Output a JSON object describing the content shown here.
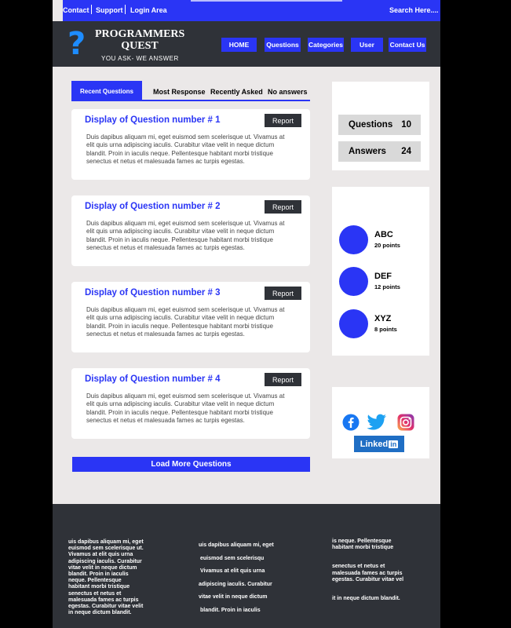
{
  "topbar": {
    "contact": "Contact",
    "support": "Support",
    "login": "Login Area",
    "search": "Search Here...."
  },
  "header": {
    "logo_title_line1": "PROGRAMMERS",
    "logo_title_line2": "QUEST",
    "tagline": "YOU ASK- WE ANSWER",
    "logo_icon": "question-mark"
  },
  "nav": [
    "HOME",
    "Questions",
    "Categories",
    "User",
    "Contact Us"
  ],
  "tabs": {
    "active": "Recent Questions",
    "others": [
      "Most Response",
      "Recently Asked",
      "No answers"
    ]
  },
  "questions": [
    {
      "title": "Display of Question number # 1",
      "report": "Report",
      "body": "Duis dapibus aliquam mi, eget euismod sem scelerisque ut. Vivamus at elit quis urna adipiscing iaculis. Curabitur vitae velit in neque dictum blandit. Proin in iaculis neque. Pellentesque habitant morbi tristique senectus et netus et malesuada fames ac turpis egestas."
    },
    {
      "title": "Display of Question number # 2",
      "report": "Report",
      "body": "Duis dapibus aliquam mi, eget euismod sem scelerisque ut. Vivamus at elit quis urna adipiscing iaculis. Curabitur vitae velit in neque dictum blandit. Proin in iaculis neque. Pellentesque habitant morbi tristique senectus et netus et malesuada fames ac turpis egestas."
    },
    {
      "title": "Display of Question number # 3",
      "report": "Report",
      "body": "Duis dapibus aliquam mi, eget euismod sem scelerisque ut. Vivamus at elit quis urna adipiscing iaculis. Curabitur vitae velit in neque dictum blandit. Proin in iaculis neque. Pellentesque habitant morbi tristique senectus et netus et malesuada fames ac turpis egestas."
    },
    {
      "title": "Display of Question number # 4",
      "report": "Report",
      "body": "Duis dapibus aliquam mi, eget euismod sem scelerisque ut. Vivamus at elit quis urna adipiscing iaculis. Curabitur vitae velit in neque dictum blandit. Proin in iaculis neque. Pellentesque habitant morbi tristique senectus et netus et malesuada fames ac turpis egestas."
    }
  ],
  "load_more": "Load More Questions",
  "stats": [
    {
      "label": "Questions",
      "value": "10"
    },
    {
      "label": "Answers",
      "value": "24"
    }
  ],
  "users": [
    {
      "name": "ABC",
      "points": "20 points"
    },
    {
      "name": "DEF",
      "points": "12 points"
    },
    {
      "name": "XYZ",
      "points": "8 points"
    }
  ],
  "social": {
    "icons": [
      "facebook-icon",
      "twitter-icon",
      "instagram-icon"
    ],
    "linkedin_text": "Linked",
    "linkedin_in": "in"
  },
  "footer": {
    "col1": [
      "uis dapibus aliquam mi, eget",
      "euismod sem scelerisque ut.",
      "Vivamus at elit quis urna",
      "adipiscing iaculis. Curabitur",
      "vitae velit in neque dictum",
      "blandit. Proin in iaculis",
      "neque. Pellentesque",
      "habitant morbi tristique",
      "senectus et netus et",
      "malesuada fames ac turpis",
      "egestas. Curabitur vitae velit",
      "in neque dictum blandit."
    ],
    "col2": [
      "uis dapibus aliquam mi, eget",
      "euismod sem scelerisqu",
      "Vivamus at elit quis urna",
      "adipiscing iaculis. Curabitur",
      "vitae velit in neque dictum",
      "blandit. Proin in iaculis"
    ],
    "col3_a": [
      "is neque. Pellentesque",
      "habitant morbi tristique"
    ],
    "col3_b": [
      "senectus et netus et",
      "malesuada fames ac turpis",
      "egestas. Curabitur vitae vel"
    ],
    "col3_c": [
      "it in neque dictum blandit."
    ]
  },
  "colors": {
    "accent": "#2a35f5",
    "dark": "#2f3238",
    "background": "#ebe8e8"
  }
}
